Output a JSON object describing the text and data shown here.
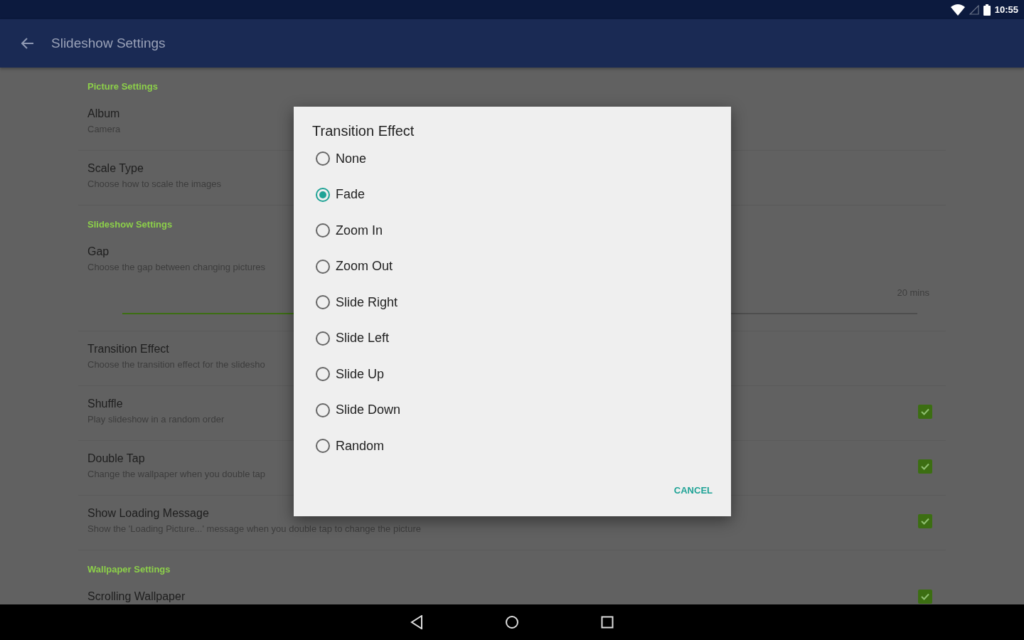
{
  "status_bar": {
    "time": "10:55"
  },
  "app_bar": {
    "title": "Slideshow Settings"
  },
  "sections": [
    {
      "title": "Picture Settings",
      "items": [
        {
          "kind": "text",
          "title": "Album",
          "summary": "Camera"
        },
        {
          "kind": "text",
          "title": "Scale Type",
          "summary": "Choose how to scale the images"
        }
      ]
    },
    {
      "title": "Slideshow Settings",
      "items": [
        {
          "kind": "slider",
          "title": "Gap",
          "summary": "Choose the gap between changing pictures",
          "reading": "20 mins",
          "level": 0.25
        },
        {
          "kind": "text",
          "title": "Transition Effect",
          "summary": "Choose the transition effect for the slidesho"
        },
        {
          "kind": "checkbox",
          "title": "Shuffle",
          "summary": "Play slideshow in a random order",
          "checked": true
        },
        {
          "kind": "checkbox",
          "title": "Double Tap",
          "summary": "Change the wallpaper when you double tap",
          "checked": true
        },
        {
          "kind": "checkbox",
          "title": "Show Loading Message",
          "summary": "Show the 'Loading Picture...' message when you double tap to change the picture",
          "checked": true
        }
      ]
    },
    {
      "title": "Wallpaper Settings",
      "items": [
        {
          "kind": "checkbox",
          "title": "Scrolling Wallpaper",
          "checked": true
        }
      ]
    }
  ],
  "dialog": {
    "title": "Transition Effect",
    "options": [
      {
        "label": "None",
        "selected": false
      },
      {
        "label": "Fade",
        "selected": true
      },
      {
        "label": "Zoom In",
        "selected": false
      },
      {
        "label": "Zoom Out",
        "selected": false
      },
      {
        "label": "Slide Right",
        "selected": false
      },
      {
        "label": "Slide Left",
        "selected": false
      },
      {
        "label": "Slide Up",
        "selected": false
      },
      {
        "label": "Slide Down",
        "selected": false
      },
      {
        "label": "Random",
        "selected": false
      }
    ],
    "buttons": [
      "CANCEL"
    ]
  }
}
